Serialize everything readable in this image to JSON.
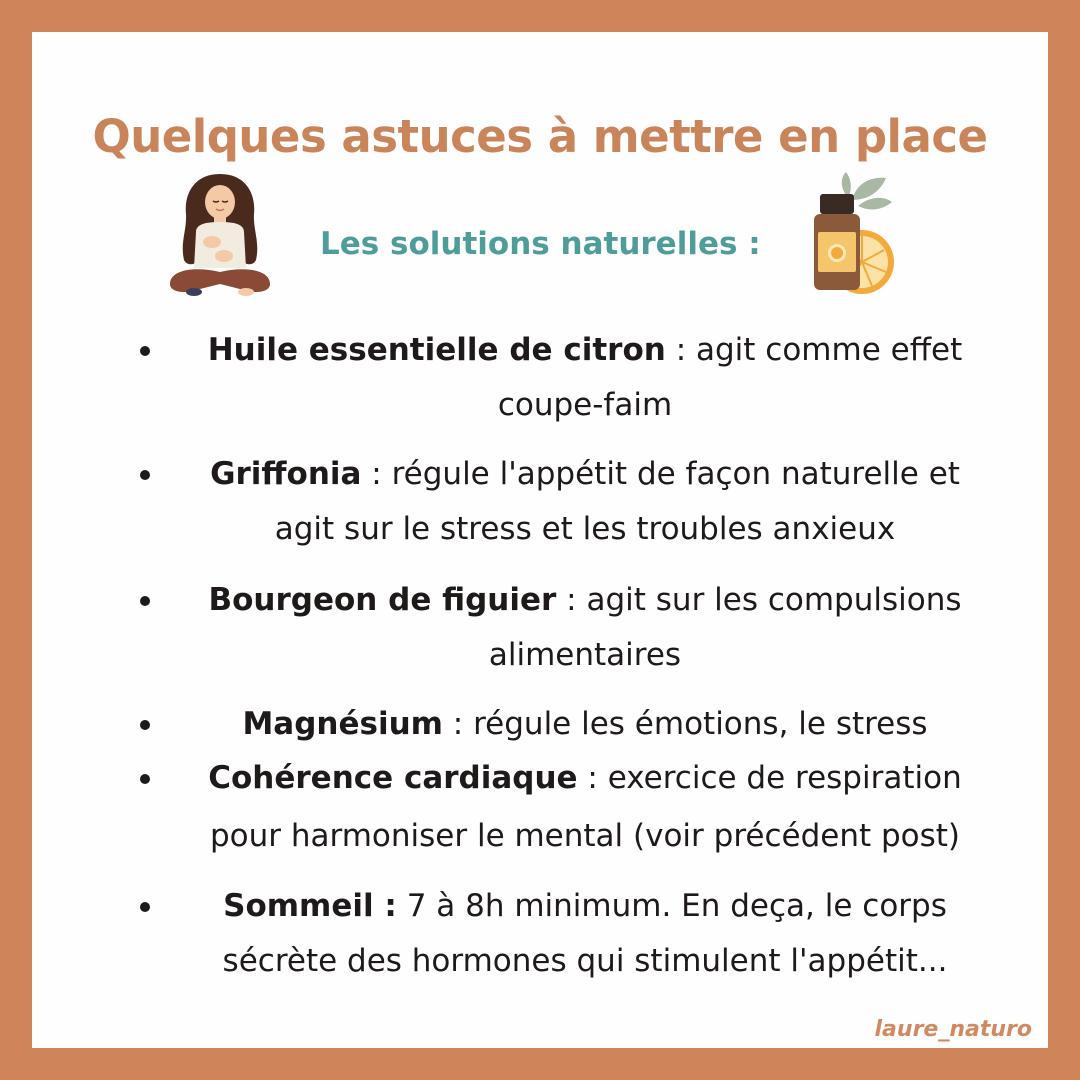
{
  "title": "Quelques astuces à mettre en place",
  "subtitle": "Les solutions naturelles :",
  "items": [
    {
      "term": "Huile essentielle de citron",
      "sep": " : ",
      "line1_rest": "agit comme effet",
      "line2": "coupe-faim"
    },
    {
      "term": "Griffonia",
      "sep": " : ",
      "line1_rest": "régule l'appétit de façon naturelle et",
      "line2": "agit sur le stress et les troubles anxieux"
    },
    {
      "term": "Bourgeon de figuier",
      "sep": " : ",
      "line1_rest": "agit sur les compulsions",
      "line2": "alimentaires"
    },
    {
      "term": "Magnésium",
      "sep": " : ",
      "line1_rest": "régule les émotions, le stress",
      "line2": ""
    },
    {
      "term": "Cohérence cardiaque",
      "sep": " : ",
      "line1_rest": "exercice de respiration",
      "line2": "pour harmoniser le mental (voir précédent post)"
    },
    {
      "term": "Sommeil :",
      "sep": " ",
      "line1_rest": "7 à 8h minimum. En deça, le corps",
      "line2": "sécrète des hormones qui stimulent l'appétit..."
    }
  ],
  "credit": "laure_naturo",
  "colors": {
    "border": "#cd8559",
    "title": "#c9845a",
    "subtitle": "#4f9d9a",
    "text": "#1f1a1a"
  },
  "icons": {
    "left": "meditating-woman-illustration",
    "right": "essential-oil-bottle-lemon-illustration"
  }
}
